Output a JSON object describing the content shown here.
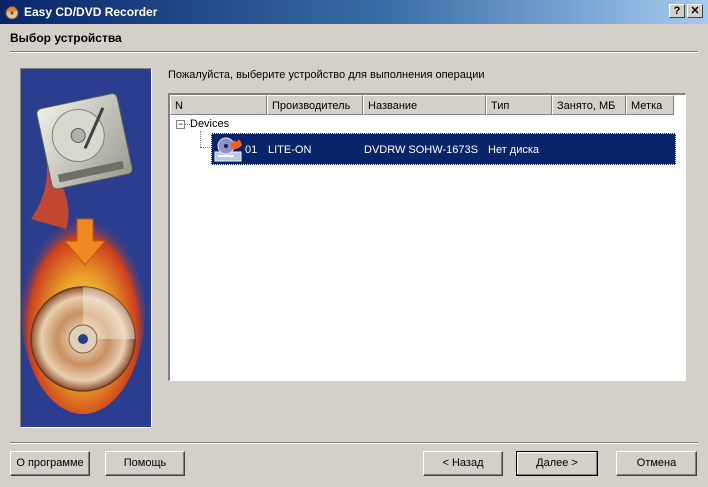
{
  "window": {
    "title": "Easy CD/DVD Recorder",
    "help_glyph": "?",
    "close_glyph": "✕"
  },
  "page": {
    "title": "Выбор устройства",
    "instruction": "Пожалуйста, выберите устройство для выполнения операции"
  },
  "device_list": {
    "columns": [
      "N",
      "Производитель",
      "Название",
      "Тип",
      "Занято, МБ",
      "Метка"
    ],
    "tree_root": "Devices",
    "expander_glyph": "−",
    "rows": [
      {
        "n": "01",
        "manufacturer": "LITE-ON",
        "name": "DVDRW SOHW-1673S",
        "type": "Нет диска",
        "used_mb": "",
        "label": ""
      }
    ]
  },
  "buttons": {
    "about": "О программе",
    "help": "Помощь",
    "back": "< Назад",
    "next": "Далее >",
    "cancel": "Отмена"
  },
  "icons": {
    "app": "cd-fire-icon",
    "drive": "dvd-drive-icon"
  },
  "colors": {
    "title_bar": "#0a246a",
    "selection": "#0a246a",
    "side_panel": "#2a3d8f",
    "face": "#d4d0c8"
  }
}
